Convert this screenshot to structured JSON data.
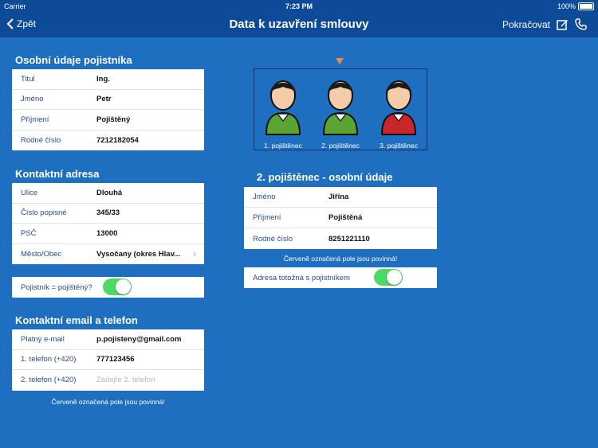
{
  "status": {
    "carrier": "Carrier",
    "time": "7:23 PM",
    "battery": "100%"
  },
  "nav": {
    "back": "Zpět",
    "title": "Data k uzavření smlouvy",
    "continue": "Pokračovat"
  },
  "owner": {
    "title": "Osobní údaje pojistníka",
    "rows": [
      {
        "label": "Titul",
        "value": "Ing."
      },
      {
        "label": "Jméno",
        "value": "Petr"
      },
      {
        "label": "Příjmení",
        "value": "Pojištěný"
      },
      {
        "label": "Rodné číslo",
        "value": "7212182054"
      }
    ]
  },
  "address": {
    "title": "Kontaktní adresa",
    "rows": [
      {
        "label": "Ulice",
        "value": "Dlouhá"
      },
      {
        "label": "Číslo popisné",
        "value": "345/33"
      },
      {
        "label": "PSČ",
        "value": "13000"
      },
      {
        "label": "Město/Obec",
        "value": "Vysočany (okres Hlav..."
      }
    ]
  },
  "owner_is_insured": {
    "label": "Pojistník = pojištěný?",
    "on": true
  },
  "contact": {
    "title": "Kontaktní email a telefon",
    "rows": [
      {
        "label": "Platný e-mail",
        "value": "p.pojisteny@gmail.com"
      },
      {
        "label": "1. telefon (+420)",
        "value": "777123456"
      },
      {
        "label": "2. telefon (+420)",
        "placeholder": "Zadejte 2. telefon"
      }
    ],
    "note": "Červeně označená pole jsou povinná!"
  },
  "insured_selector": {
    "persons": [
      {
        "label": "1. pojištěnec",
        "shirt_color": "#5aa532"
      },
      {
        "label": "2. pojištěnec",
        "shirt_color": "#5aa532"
      },
      {
        "label": "3. pojištěnec",
        "shirt_color": "#c8262a"
      }
    ],
    "selected_index": 1
  },
  "insured": {
    "title": "2. pojištěnec - osobní údaje",
    "rows": [
      {
        "label": "Jméno",
        "value": "Jiřina"
      },
      {
        "label": "Příjmení",
        "value": "Pojištěná"
      },
      {
        "label": "Rodné číslo",
        "value": "8251221110"
      }
    ],
    "note": "Červeně označená pole jsou povinná!",
    "same_address": {
      "label": "Adresa totožná s pojistníkem",
      "on": true
    }
  },
  "colors": {
    "background": "#1e6fc0",
    "navbar": "#0d4a97",
    "label": "#2b4a86",
    "toggle_on": "#4cd964",
    "marker": "#f0883e"
  }
}
